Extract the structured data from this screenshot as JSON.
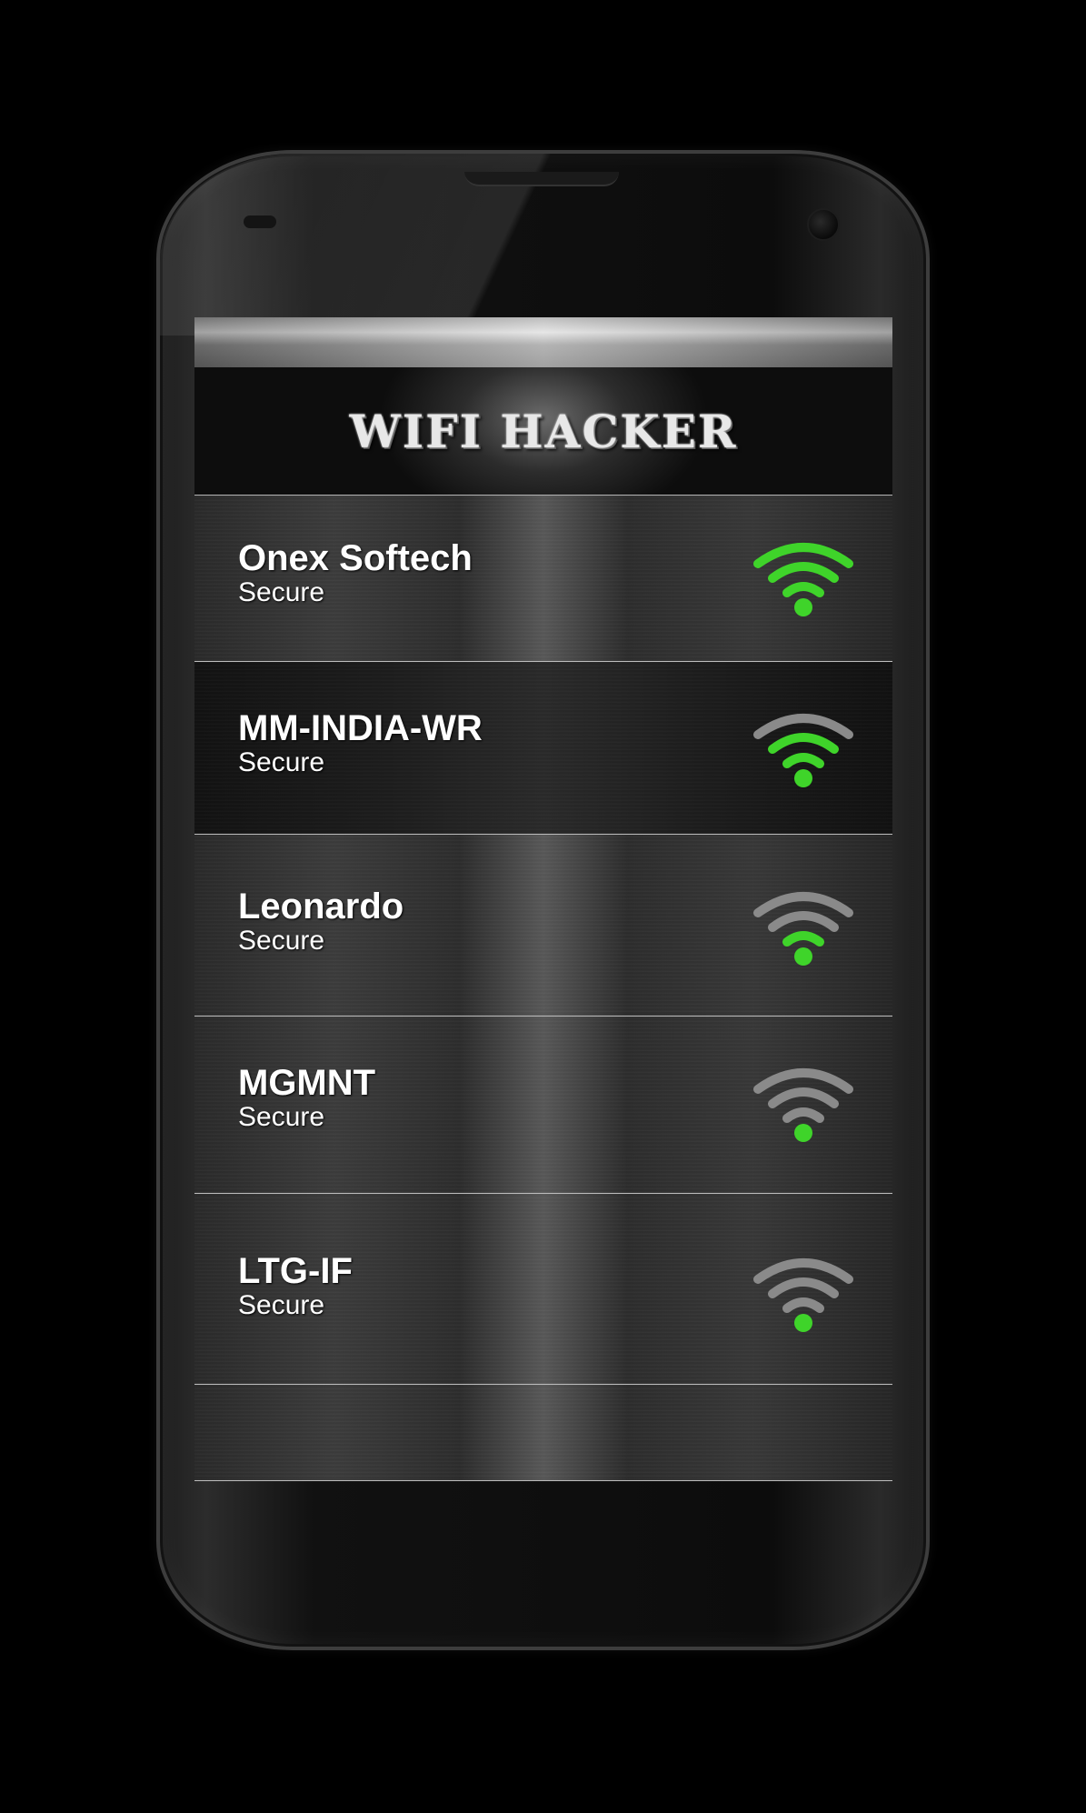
{
  "app": {
    "title": "WIFI HACKER"
  },
  "networks": [
    {
      "name": "Onex Softech",
      "status": "Secure",
      "signal_bars": 3,
      "signal_max": 3
    },
    {
      "name": "MM-INDIA-WR",
      "status": "Secure",
      "signal_bars": 2,
      "signal_max": 3
    },
    {
      "name": "Leonardo",
      "status": "Secure",
      "signal_bars": 1,
      "signal_max": 3
    },
    {
      "name": "MGMNT",
      "status": "Secure",
      "signal_bars": 0,
      "signal_max": 3
    },
    {
      "name": "LTG-IF",
      "status": "Secure",
      "signal_bars": 0,
      "signal_max": 3
    }
  ],
  "icons": {
    "signal": "wifi-signal-icon"
  },
  "colors": {
    "signal_active": "#3fd42a",
    "signal_inactive": "#8a8a8a",
    "text": "#ffffff",
    "background": "#000000"
  }
}
